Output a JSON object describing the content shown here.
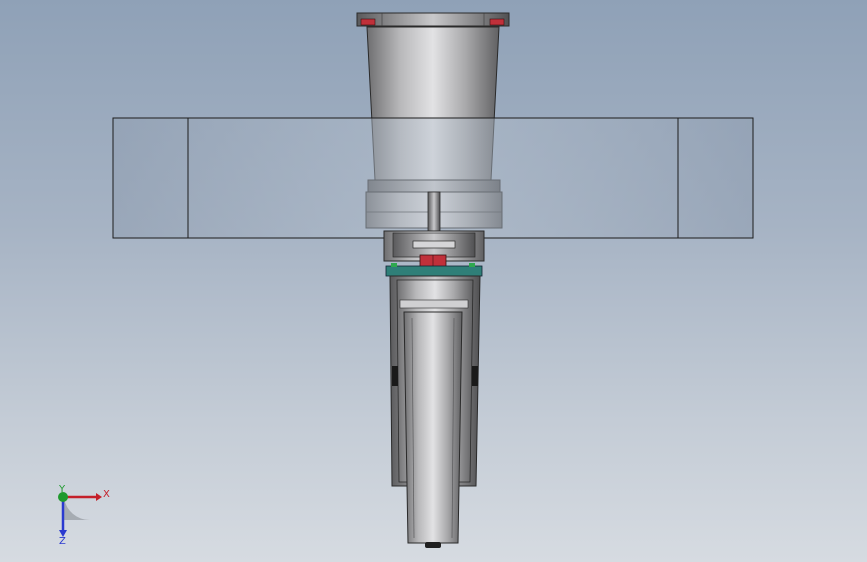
{
  "viewport": {
    "background_top": "#8fa1b7",
    "background_bottom": "#d6dbe1"
  },
  "model": {
    "parts": [
      "top-flange",
      "motor-housing",
      "frame-panel",
      "shaft",
      "coupling",
      "mount-plate",
      "caster-fork",
      "wheel"
    ],
    "accent_red": "#c0303a",
    "accent_teal": "#2f7f78",
    "accent_green": "#2fa84f"
  },
  "triad": {
    "x_label": "X",
    "y_label": "Y",
    "z_label": "Z",
    "x_color": "#c4202a",
    "y_color": "#1f9a2e",
    "z_color": "#2a3ad0"
  }
}
